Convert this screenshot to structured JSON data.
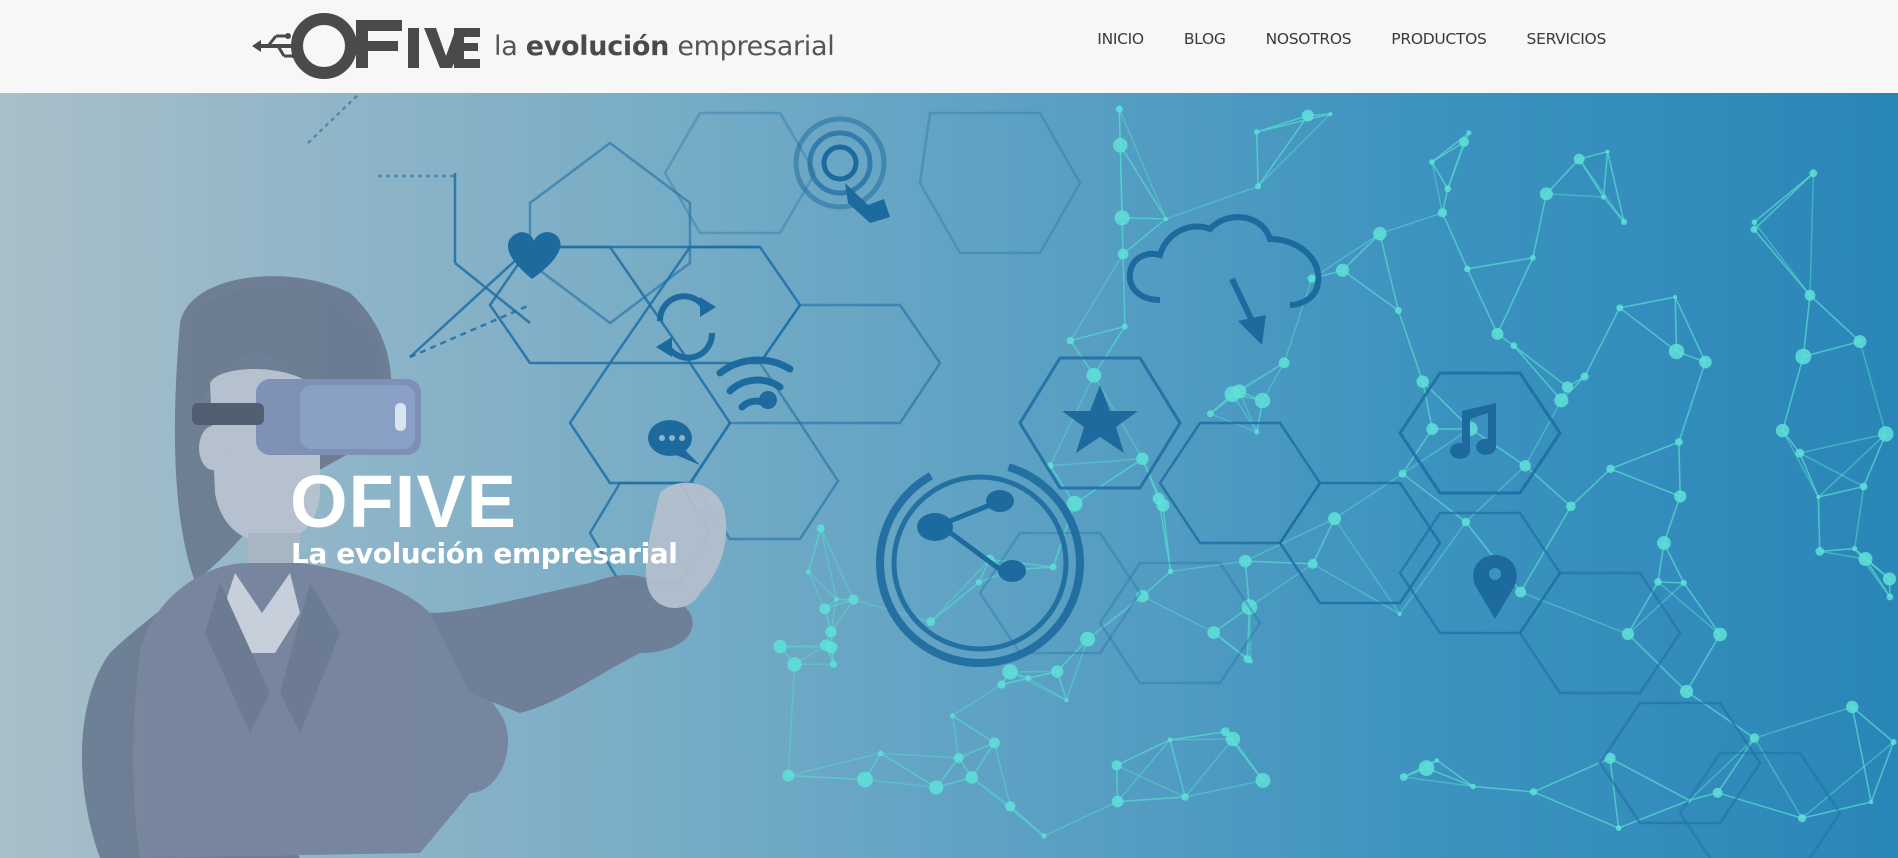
{
  "header": {
    "logo_text": "OFIVE",
    "tagline_prefix": "la",
    "tagline_bold": "evolución",
    "tagline_suffix": "empresarial"
  },
  "nav": {
    "items": [
      {
        "label": "INICIO"
      },
      {
        "label": "BLOG"
      },
      {
        "label": "NOSOTROS"
      },
      {
        "label": "PRODUCTOS"
      },
      {
        "label": "SERVICIOS"
      }
    ]
  },
  "hero": {
    "title": "OFIVE",
    "subtitle": "La evolución empresarial"
  },
  "colors": {
    "header_bg": "#f7f7f7",
    "nav_text": "#3a3a3a",
    "hero_left": "#a9bfc8",
    "hero_right": "#2a86b8",
    "line_dark": "#1e6a9c",
    "node_cyan": "#49d6d0",
    "figure": "#6f8098"
  },
  "icons": [
    "usb-icon",
    "heart-icon",
    "refresh-icon",
    "touch-icon",
    "wifi-icon",
    "chat-icon",
    "cloud-download-icon",
    "star-icon",
    "share-icon",
    "music-note-icon",
    "location-pin-icon",
    "vr-headset-icon"
  ]
}
